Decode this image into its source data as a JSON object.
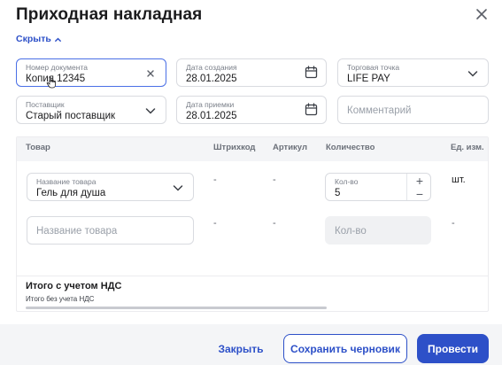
{
  "dialog": {
    "title": "Приходная накладная"
  },
  "toggle": {
    "label": "Скрыть"
  },
  "fields": {
    "doc_number": {
      "label": "Номер документа",
      "value": "Копия 12345"
    },
    "created": {
      "label": "Дата создания",
      "value": "28.01.2025"
    },
    "shop": {
      "label": "Торговая точка",
      "value": "LIFE PAY"
    },
    "supplier": {
      "label": "Поставщик",
      "value": "Старый поставщик"
    },
    "received": {
      "label": "Дата приемки",
      "value": "28.01.2025"
    },
    "comment": {
      "placeholder": "Комментарий"
    }
  },
  "table": {
    "columns": [
      "Товар",
      "Штрихкод",
      "Артикул",
      "Количество",
      "Ед. изм."
    ],
    "rows": [
      {
        "product_label": "Название товара",
        "product_value": "Гель для душа",
        "barcode": "-",
        "article": "-",
        "qty_label": "Кол-во",
        "qty_value": "5",
        "unit": "шт."
      },
      {
        "product_placeholder": "Название товара",
        "barcode": "-",
        "article": "-",
        "qty_placeholder": "Кол-во",
        "unit": "-"
      }
    ],
    "stepper": {
      "plus": "+",
      "minus": "−"
    },
    "total": "Итого с учетом НДС",
    "total_sub": "Итого без учета НДС"
  },
  "actions": {
    "close": "Закрыть",
    "draft": "Сохранить черновик",
    "post": "Провести"
  },
  "colors": {
    "accent": "#2d50c8",
    "focus_border": "#4a6fe6"
  }
}
